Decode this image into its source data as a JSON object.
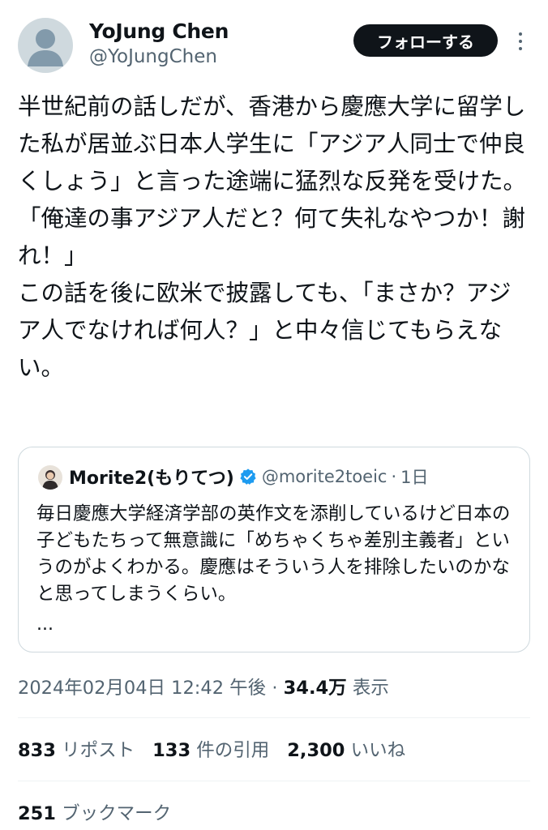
{
  "author": {
    "name": "YoJung Chen",
    "handle": "@YoJungChen",
    "avatar_icon": "default-avatar-icon"
  },
  "follow_button": {
    "label": "フォローする"
  },
  "more_menu": {
    "icon": "more-vertical-icon"
  },
  "tweet": {
    "text": "半世紀前の話しだが、香港から慶應大学に留学した私が居並ぶ日本人学生に「アジア人同士で仲良くしょう」と言った途端に猛烈な反発を受けた。\n「俺達の事アジア人だと？何て失礼なやつか！謝れ！」\nこの話を後に欧米で披露しても、「まさか？アジア人でなければ何人？」と中々信じてもらえない。"
  },
  "quote": {
    "name": "Morite2(もりてつ)",
    "verified_icon": "verified-badge-icon",
    "handle": "@morite2toeic",
    "separator": "·",
    "time": "1日",
    "text": "毎日慶應大学経済学部の英作文を添削しているけど日本の子どもたちって無意識に「めちゃくちゃ差別主義者」というのがよくわかる。慶應はそういう人を排除したいのかなと思ってしまうくらい。",
    "more": "..."
  },
  "meta": {
    "timestamp": "2024年02月04日 12:42 午後",
    "separator": "·",
    "views_count": "34.4万",
    "views_label": "表示"
  },
  "stats": {
    "reposts_count": "833",
    "reposts_label": "リポスト",
    "quotes_count": "133",
    "quotes_label": "件の引用",
    "likes_count": "2,300",
    "likes_label": "いいね",
    "bookmarks_count": "251",
    "bookmarks_label": "ブックマーク"
  },
  "colors": {
    "text_primary": "#0f1419",
    "text_secondary": "#536471",
    "verified_blue": "#1d9bf0",
    "button_bg": "#0f1419",
    "border": "#cfd9de"
  }
}
